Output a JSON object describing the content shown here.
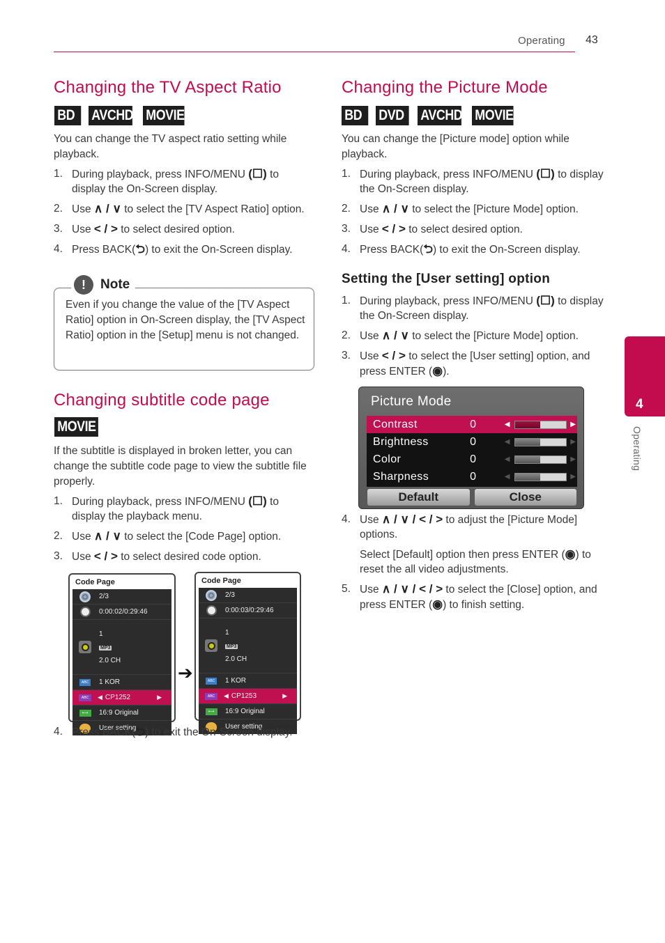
{
  "header": {
    "section": "Operating",
    "page_number": "43"
  },
  "side_tab": {
    "chapter": "4",
    "label": "Operating",
    "color": "#c30c4e"
  },
  "symbols": {
    "up_down": "∧ / ∨",
    "left_right": "< / >",
    "all_dirs": "∧ / ∨ / < / >",
    "info_menu": "(☐)",
    "back": "⮌",
    "enter": "◉"
  },
  "tv_aspect": {
    "title": "Changing the TV Aspect Ratio",
    "badges": [
      "BD",
      "AVCHD",
      "MOVIE"
    ],
    "intro": "You can change the TV aspect ratio setting while playback.",
    "steps": [
      {
        "num": "1.",
        "pre": "During playback, press INFO/MENU ",
        "sym": "(☐)",
        "post": " to display the On-Screen display."
      },
      {
        "num": "2.",
        "pre": "Use ",
        "sym": "∧ / ∨",
        "post": " to select the [TV Aspect Ratio] option."
      },
      {
        "num": "3.",
        "pre": "Use ",
        "sym": "< / >",
        "post": " to select desired option."
      },
      {
        "num": "4.",
        "pre": "Press BACK(",
        "sym": "⮌",
        "post": ") to exit the On-Screen display."
      }
    ],
    "note": {
      "label": "Note",
      "icon": "!",
      "text": "Even if you change the value of the [TV Aspect Ratio] option in On-Screen display, the [TV Aspect Ratio] option in the [Setup] menu is not changed."
    }
  },
  "subtitle": {
    "title": "Changing subtitle code page",
    "badges": [
      "MOVIE"
    ],
    "intro": "If the subtitle is displayed in broken letter, you can change the subtitle code page to view the subtitle file properly.",
    "steps": [
      {
        "num": "1.",
        "pre": "During playback, press INFO/MENU ",
        "sym": "(☐)",
        "post": " to display the playback menu."
      },
      {
        "num": "2.",
        "pre": "Use ",
        "sym": "∧ / ∨",
        "post": " to select the [Code Page] option."
      },
      {
        "num": "3.",
        "pre": "Use ",
        "sym": "< / >",
        "post": " to select desired code option."
      }
    ],
    "step4": {
      "num": "4.",
      "pre": "Press BACK(",
      "sym": "⮌",
      "post": ") to exit the On-Screen display."
    },
    "panels": [
      {
        "title": "Code Page",
        "title_rows": "2/3",
        "time": "0:00:02/0:29:46",
        "audio_track": "1",
        "audio_codec": "MP3",
        "audio_ch": "2.0 CH",
        "subtitle": "1 KOR",
        "code_page": "CP1252",
        "aspect": "16:9 Original",
        "picture": "User setting"
      },
      {
        "title": "Code Page",
        "title_rows": "2/3",
        "time": "0:00:03/0:29:46",
        "audio_track": "1",
        "audio_codec": "MP3",
        "audio_ch": "2.0 CH",
        "subtitle": "1 KOR",
        "code_page": "CP1253",
        "aspect": "16:9 Original",
        "picture": "User setting"
      }
    ],
    "abc_label": "ABC"
  },
  "picture_mode": {
    "title": "Changing the Picture Mode",
    "badges": [
      "BD",
      "DVD",
      "AVCHD",
      "MOVIE"
    ],
    "intro": "You can change the [Picture mode] option while playback.",
    "steps": [
      {
        "num": "1.",
        "pre": "During playback, press INFO/MENU ",
        "sym": "(☐)",
        "post": " to display the On-Screen display."
      },
      {
        "num": "2.",
        "pre": "Use ",
        "sym": "∧ / ∨",
        "post": " to select the [Picture Mode] option."
      },
      {
        "num": "3.",
        "pre": "Use ",
        "sym": "< / >",
        "post": " to select desired option."
      },
      {
        "num": "4.",
        "pre": "Press BACK(",
        "sym": "⮌",
        "post": ") to exit the On-Screen display."
      }
    ],
    "user_setting": {
      "title": "Setting the [User setting] option",
      "steps": [
        {
          "num": "1.",
          "pre": "During playback, press INFO/MENU ",
          "sym": "(☐)",
          "post": " to display the On-Screen display."
        },
        {
          "num": "2.",
          "pre": "Use ",
          "sym": "∧ / ∨",
          "post": " to select the [Picture Mode] option."
        },
        {
          "num": "3.",
          "pre": "Use ",
          "sym": "< / >",
          "post": " to select the [User setting] option, and press ENTER (",
          "sym2": "◉",
          "post2": ")."
        }
      ],
      "steps_after": [
        {
          "num": "4.",
          "pre": "Use ",
          "sym": "∧ / ∨ / < / >",
          "post": " to adjust the [Picture Mode] options."
        },
        {
          "num": "",
          "pre": "Select [Default] option then press ENTER (",
          "sym": "◉",
          "post": ") to reset the all video adjustments."
        },
        {
          "num": "5.",
          "pre": "Use ",
          "sym": "∧ / ∨ / < / >",
          "post": " to select the [Close] option, and press ENTER (",
          "sym2": "◉",
          "post2": ") to finish setting."
        }
      ]
    },
    "dialog": {
      "title": "Picture Mode",
      "rows": [
        {
          "label": "Contrast",
          "value": "0",
          "level_pct": 50,
          "selected": true
        },
        {
          "label": "Brightness",
          "value": "0",
          "level_pct": 50,
          "selected": false
        },
        {
          "label": "Color",
          "value": "0",
          "level_pct": 50,
          "selected": false
        },
        {
          "label": "Sharpness",
          "value": "0",
          "level_pct": 50,
          "selected": false
        }
      ],
      "buttons": {
        "default": "Default",
        "close": "Close"
      }
    }
  }
}
